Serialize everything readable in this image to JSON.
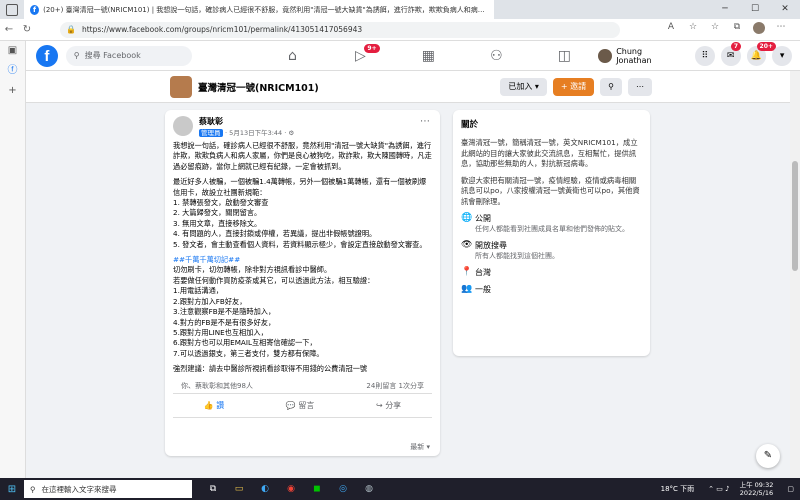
{
  "browser": {
    "tab_title": "(20+) 臺灣清冠一號(NRICM101) | 我想說一句話，確診病人已經很不舒服，竟然利用\"清冠一號大缺貨\"為誘餌，進行詐欺，欺欺負病人和病人... | Facebook",
    "url": "https://www.facebook.com/groups/nricm101/permalink/413051417056943"
  },
  "fb": {
    "search_placeholder": "搜尋 Facebook",
    "watch_badge": "9+",
    "profile_name": "Chung Jonathan",
    "messenger_badge": "7",
    "notif_badge": "20+"
  },
  "group": {
    "name": "臺灣清冠一號(NRICM101)",
    "joined_label": "已加入 ▾",
    "invite_label": "+ 邀請"
  },
  "post": {
    "author": "蔡耿彰",
    "role": "管理員",
    "meta": "· 5月13日下午3:44 · ⚙",
    "paragraphs": [
      "我想說一句話，確診病人已經很不舒服，竟然利用\"清冠一號大缺貨\"為誘餌，進行詐欺，欺欺負病人和病人家屬，你們是良心被狗吃，欺詐欺，欺大陳國轉時，凡走過必留痕跡，當你上網就已經有紀錄，一定會被抓到。",
      "最近好多人被騙，一個被騙1.4萬轉帳，另外一個被騙1萬轉帳，還有一個被刷爆信用卡，故設立社團新規範：\n1. 禁轉張發文，啟動發文審查\n2. 大篇歸發文，關閉留言。\n3. 無用文章，直接移除文。\n4. 有問題的人，直接封鎖或停權，若異議，提出非假帳號證明。\n5. 發文者，會主動查看個人資料，若資料顯示極少，會設定直接啟動發文審查。",
      "##千萬千萬切記##\n切勿刷卡，切勿轉帳，除非對方視訊看診中醫師。\n若要做任何動作買防疫茶或其它，可以透過此方法，相互驗證：\n1.用電話溝通，\n2.跟對方加入FB好友，\n3.注意觀察FB是不是隨時加入，\n4.對方的FB是不是有很多好友，\n5.跟對方用LINE也互相加入，\n6.跟對方也可以用EMAIL互相寄信確認一下，\n7.可以透過銀支，第三者支付，雙方都有保障。",
      "強烈建議：請去中醫診所視訊看診取得不用錢的公費清冠一號"
    ],
    "highlight": "##千萬千萬切記##",
    "reactions": "你、蔡耿彰和其他98人",
    "comments_shares": "24則留言 1次分享",
    "like_label": "讚",
    "comment_label": "留言",
    "share_label": "分享",
    "sort_label": "最新 ▾"
  },
  "about": {
    "title": "關於",
    "p1": "臺灣清冠一號，簡稱清冠一號，英文NRICM101，成立此網站的目的讓大家彼此交流訊息，互相幫忙，提供訊息，協助那些無助的人，對抗新冠病毒。",
    "p2": "歡迎大家把有關清冠一號，疫情經驗，疫情或病毒相關訊息可以po，八家按權清冠一號黃衛也可以po，其他資訊會刪除理。",
    "public_title": "公開",
    "public_desc": "任何人都能看到社團成員名單和他們發佈的貼文。",
    "visible_title": "開放搜尋",
    "visible_desc": "所有人都能找到這個社團。",
    "location": "台灣",
    "general": "一般"
  },
  "taskbar": {
    "search_placeholder": "在這裡輸入文字來搜尋",
    "weather": "18°C 下雨",
    "time": "上午 09:32",
    "date": "2022/5/16"
  }
}
